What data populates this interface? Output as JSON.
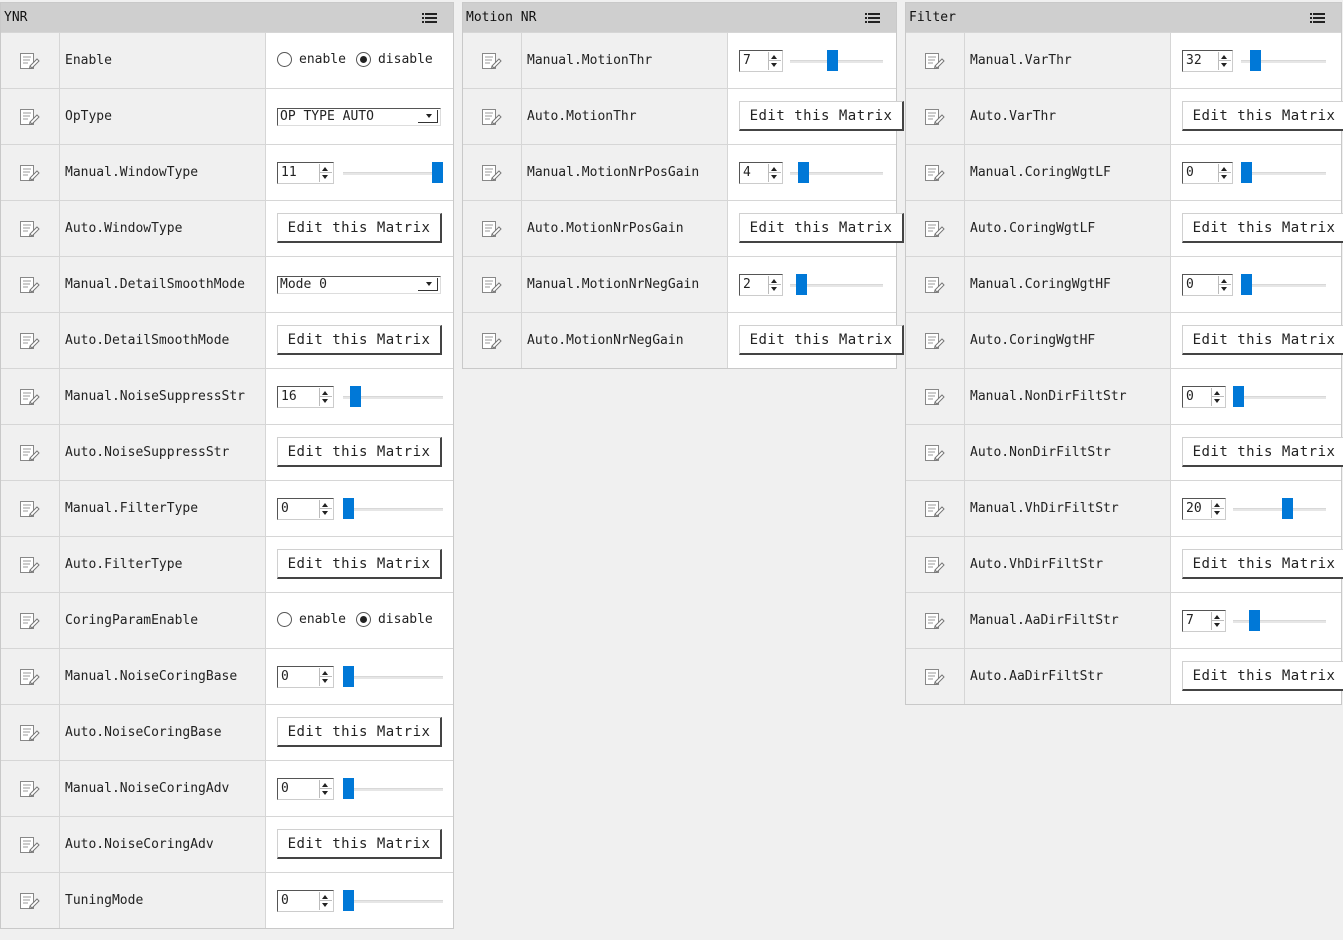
{
  "panels": [
    {
      "title": "YNR",
      "rows": [
        {
          "label": "Enable",
          "type": "radio",
          "options": [
            "enable",
            "disable"
          ],
          "selected": 1
        },
        {
          "label": "OpType",
          "type": "combo",
          "value": "OP TYPE AUTO"
        },
        {
          "label": "Manual.WindowType",
          "type": "slider",
          "value": "11",
          "level": 1.0
        },
        {
          "label": "Auto.WindowType",
          "type": "matrix",
          "button": "Edit this Matrix"
        },
        {
          "label": "Manual.DetailSmoothMode",
          "type": "combo",
          "value": "Mode 0"
        },
        {
          "label": "Auto.DetailSmoothMode",
          "type": "matrix",
          "button": "Edit this Matrix"
        },
        {
          "label": "Manual.NoiseSuppressStr",
          "type": "slider",
          "value": "16",
          "level": 0.08
        },
        {
          "label": "Auto.NoiseSuppressStr",
          "type": "matrix",
          "button": "Edit this Matrix"
        },
        {
          "label": "Manual.FilterType",
          "type": "slider",
          "value": "0",
          "level": 0.0
        },
        {
          "label": "Auto.FilterType",
          "type": "matrix",
          "button": "Edit this Matrix"
        },
        {
          "label": "CoringParamEnable",
          "type": "radio",
          "options": [
            "enable",
            "disable"
          ],
          "selected": 1
        },
        {
          "label": "Manual.NoiseCoringBase",
          "type": "slider",
          "value": "0",
          "level": 0.0
        },
        {
          "label": "Auto.NoiseCoringBase",
          "type": "matrix",
          "button": "Edit this Matrix"
        },
        {
          "label": "Manual.NoiseCoringAdv",
          "type": "slider",
          "value": "0",
          "level": 0.0
        },
        {
          "label": "Auto.NoiseCoringAdv",
          "type": "matrix",
          "button": "Edit this Matrix"
        },
        {
          "label": "TuningMode",
          "type": "slider",
          "value": "0",
          "level": 0.0
        }
      ]
    },
    {
      "title": "Motion NR",
      "rows": [
        {
          "label": "Manual.MotionThr",
          "type": "slider",
          "value": "7",
          "level": 0.45
        },
        {
          "label": "Auto.MotionThr",
          "type": "matrix",
          "button": "Edit this Matrix"
        },
        {
          "label": "Manual.MotionNrPosGain",
          "type": "slider",
          "value": "4",
          "level": 0.1
        },
        {
          "label": "Auto.MotionNrPosGain",
          "type": "matrix",
          "button": "Edit this Matrix"
        },
        {
          "label": "Manual.MotionNrNegGain",
          "type": "slider",
          "value": "2",
          "level": 0.07
        },
        {
          "label": "Auto.MotionNrNegGain",
          "type": "matrix",
          "button": "Edit this Matrix"
        }
      ]
    },
    {
      "title": "Filter",
      "rows": [
        {
          "label": "Manual.VarThr",
          "type": "slider",
          "value": "32",
          "level": 0.12
        },
        {
          "label": "Auto.VarThr",
          "type": "matrix",
          "button": "Edit this Matrix"
        },
        {
          "label": "Manual.CoringWgtLF",
          "type": "slider",
          "value": "0",
          "level": 0.0
        },
        {
          "label": "Auto.CoringWgtLF",
          "type": "matrix",
          "button": "Edit this Matrix"
        },
        {
          "label": "Manual.CoringWgtHF",
          "type": "slider",
          "value": "0",
          "level": 0.0
        },
        {
          "label": "Auto.CoringWgtHF",
          "type": "matrix",
          "button": "Edit this Matrix"
        },
        {
          "label": "Manual.NonDirFiltStr",
          "type": "slider",
          "value": "0",
          "level": 0.0
        },
        {
          "label": "Auto.NonDirFiltStr",
          "type": "matrix",
          "button": "Edit this Matrix"
        },
        {
          "label": "Manual.VhDirFiltStr",
          "type": "slider",
          "value": "20",
          "level": 0.6
        },
        {
          "label": "Auto.VhDirFiltStr",
          "type": "matrix",
          "button": "Edit this Matrix"
        },
        {
          "label": "Manual.AaDirFiltStr",
          "type": "slider",
          "value": "7",
          "level": 0.2
        },
        {
          "label": "Auto.AaDirFiltStr",
          "type": "matrix",
          "button": "Edit this Matrix"
        }
      ]
    }
  ],
  "icons": {
    "row": "edit-document-icon",
    "header": "list-menu-icon"
  },
  "colors": {
    "accent": "#0078d7",
    "header": "#cfcfcf",
    "label_bg": "#f0f0f0"
  }
}
